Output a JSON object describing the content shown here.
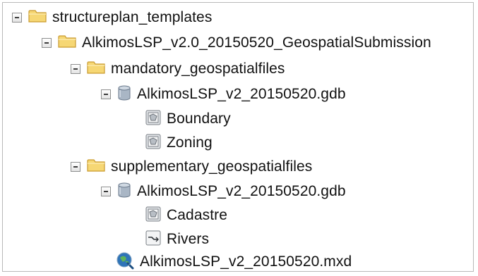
{
  "tree": {
    "root": {
      "label": "structureplan_templates",
      "icon": "folder-icon",
      "expanded": true
    },
    "submission": {
      "label": "AlkimosLSP_v2.0_20150520_GeospatialSubmission",
      "icon": "folder-icon",
      "expanded": true
    },
    "mandatory": {
      "label": "mandatory_geospatialfiles",
      "icon": "folder-icon",
      "expanded": true,
      "gdb": {
        "label": "AlkimosLSP_v2_20150520.gdb",
        "icon": "geodatabase-icon",
        "expanded": true,
        "items": [
          {
            "label": "Boundary",
            "icon": "polygon-feature-class-icon"
          },
          {
            "label": "Zoning",
            "icon": "polygon-feature-class-icon"
          }
        ]
      }
    },
    "supplementary": {
      "label": "supplementary_geospatialfiles",
      "icon": "folder-icon",
      "expanded": true,
      "gdb": {
        "label": "AlkimosLSP_v2_20150520.gdb",
        "icon": "geodatabase-icon",
        "expanded": true,
        "items": [
          {
            "label": "Cadastre",
            "icon": "polygon-feature-class-icon"
          },
          {
            "label": "Rivers",
            "icon": "line-feature-class-icon"
          }
        ]
      }
    },
    "mxd": {
      "label": "AlkimosLSP_v2_20150520.mxd",
      "icon": "map-document-icon"
    }
  },
  "colors": {
    "folder_fill": "#f6d774",
    "folder_border": "#c99a2e",
    "database_fill": "#a9b6c5",
    "map_document_blue": "#2f74b8"
  }
}
